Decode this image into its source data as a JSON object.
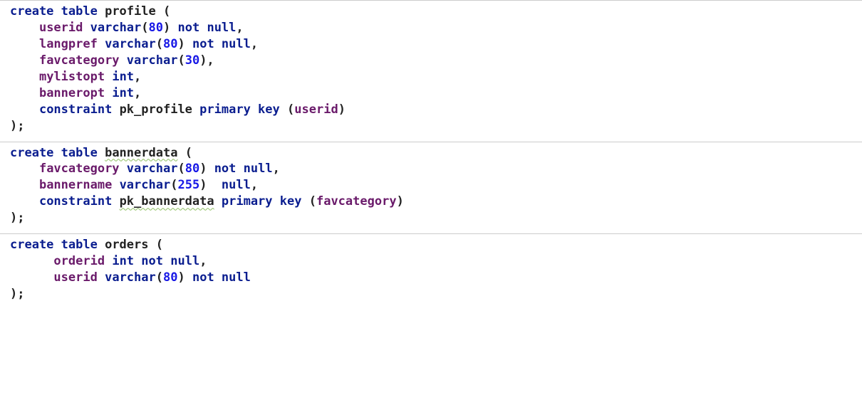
{
  "common": {
    "create_table": "create table",
    "varchar": "varchar",
    "not_null": "not null",
    "null": "null",
    "int": "int",
    "constraint": "constraint",
    "primary_key": "primary key"
  },
  "profile": {
    "name": "profile",
    "cols": {
      "userid": "userid",
      "langpref": "langpref",
      "favcategory": "favcategory",
      "mylistopt": "mylistopt",
      "banneropt": "banneropt"
    },
    "sizes": {
      "s80": "80",
      "s30": "30"
    },
    "pk_name": "pk_profile",
    "pk_col": "userid"
  },
  "bannerdata": {
    "name": "bannerdata",
    "cols": {
      "favcategory": "favcategory",
      "bannername": "bannername"
    },
    "sizes": {
      "s80": "80",
      "s255": "255"
    },
    "pk_name": "pk_bannerdata",
    "pk_col": "favcategory"
  },
  "orders": {
    "name": "orders",
    "cols": {
      "orderid": "orderid",
      "userid": "userid"
    },
    "sizes": {
      "s80": "80"
    }
  }
}
